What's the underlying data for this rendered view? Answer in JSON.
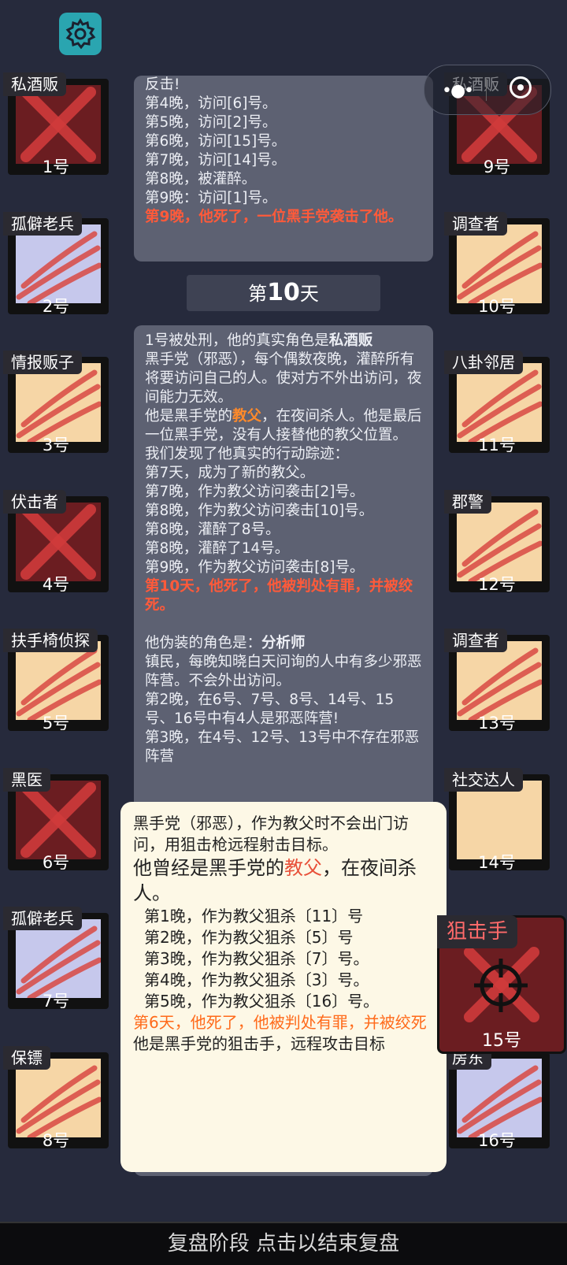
{
  "settings_icon": "gear-icon",
  "capsule": {
    "menu_icon": "more-dots-icon",
    "close_icon": "target-circle-icon"
  },
  "left_players": [
    {
      "role": "私酒贩",
      "num": "1号",
      "bg": "red",
      "dead": "cross"
    },
    {
      "role": "孤僻老兵",
      "num": "2号",
      "bg": "lav",
      "dead": "claw"
    },
    {
      "role": "情报贩子",
      "num": "3号",
      "bg": "peach",
      "dead": "claw"
    },
    {
      "role": "伏击者",
      "num": "4号",
      "bg": "red",
      "dead": "cross"
    },
    {
      "role": "扶手椅侦探",
      "num": "5号",
      "bg": "peach",
      "dead": "claw"
    },
    {
      "role": "黑医",
      "num": "6号",
      "bg": "red",
      "dead": "cross"
    },
    {
      "role": "孤僻老兵",
      "num": "7号",
      "bg": "lav",
      "dead": "claw"
    },
    {
      "role": "保镖",
      "num": "8号",
      "bg": "peach",
      "dead": "claw"
    }
  ],
  "right_players": [
    {
      "role": "私酒贩",
      "num": "9号",
      "bg": "red",
      "dead": "cross"
    },
    {
      "role": "调查者",
      "num": "10号",
      "bg": "peach",
      "dead": "claw"
    },
    {
      "role": "八卦邻居",
      "num": "11号",
      "bg": "peach",
      "dead": "claw"
    },
    {
      "role": "郡警",
      "num": "12号",
      "bg": "peach",
      "dead": "claw"
    },
    {
      "role": "调查者",
      "num": "13号",
      "bg": "peach",
      "dead": "claw"
    },
    {
      "role": "社交达人",
      "num": "14号",
      "bg": "peach",
      "dead": "none"
    },
    {
      "role": "狙击手",
      "num": "15号",
      "bg": "red",
      "dead": "cross"
    },
    {
      "role": "房东",
      "num": "16号",
      "bg": "lav",
      "dead": "claw"
    }
  ],
  "log_top": {
    "lines": [
      "反击!",
      "第4晚，访问[6]号。",
      "第5晚，访问[2]号。",
      "第6晚，访问[15]号。",
      "第7晚，访问[14]号。",
      "第8晚，被灌醉。",
      "第9晚：访问[1]号。"
    ],
    "death": "第9晚，他死了，一位黑手党袭击了他。"
  },
  "day_header": {
    "prefix": "第",
    "day": "10",
    "suffix": "天"
  },
  "log_main": {
    "intro_a": "1号被处刑，他的真实角色是",
    "intro_role": "私酒贩",
    "desc": "黑手党（邪恶），每个偶数夜晚，灌醉所有将要访问自己的人。使对方不外出访问，夜间能力无效。",
    "godfather_a": "他是黑手党的",
    "godfather_role": "教父",
    "godfather_b": "，在夜间杀人。他是最后一位黑手党，没有人接替他的教父位置。",
    "trace": "我们发现了他真实的行动踪迹：",
    "actions": [
      "第7天，成为了新的教父。",
      "第7晚，作为教父访问袭击[2]号。",
      "第8晚，作为教父访问袭击[10]号。",
      "第8晚，灌醉了8号。",
      "第8晚，灌醉了14号。",
      "第9晚，作为教父访问袭击[8]号。"
    ],
    "death": "第10天，他死了，他被判处有罪，并被绞死。",
    "disguise_label": "他伪装的角色是：",
    "disguise_role": "分析师",
    "disguise_desc": "镇民，每晚知晓白天问询的人中有多少邪恶阵营。不会外出访问。",
    "n2": "第2晚，在6号、7号、8号、14号、15号、16号中有4人是邪恶阵营!",
    "n3": "第3晚，在4号、12号、13号中不存在邪恶阵营"
  },
  "popup": {
    "line1": "黑手党（邪恶），作为教父时不会出门访问，用狙击枪远程射击目标。",
    "line2a": "他曾经是黑手党的",
    "line2_role": "教父",
    "line2b": "，在夜间杀人。",
    "nights": [
      "第1晚，作为教父狙杀〔11〕号",
      "第2晚，作为教父狙杀〔5〕号",
      "第3晚，作为教父狙杀〔7〕号。",
      "第4晚，作为教父狙杀〔3〕号。",
      "第5晚，作为教父狙杀〔16〕号。"
    ],
    "death": "第6天，他死了，他被判处有罪，并被绞死",
    "footer": "他是黑手党的狙击手，远程攻击目标"
  },
  "bottom_bar": "复盘阶段 点击以结束复盘"
}
